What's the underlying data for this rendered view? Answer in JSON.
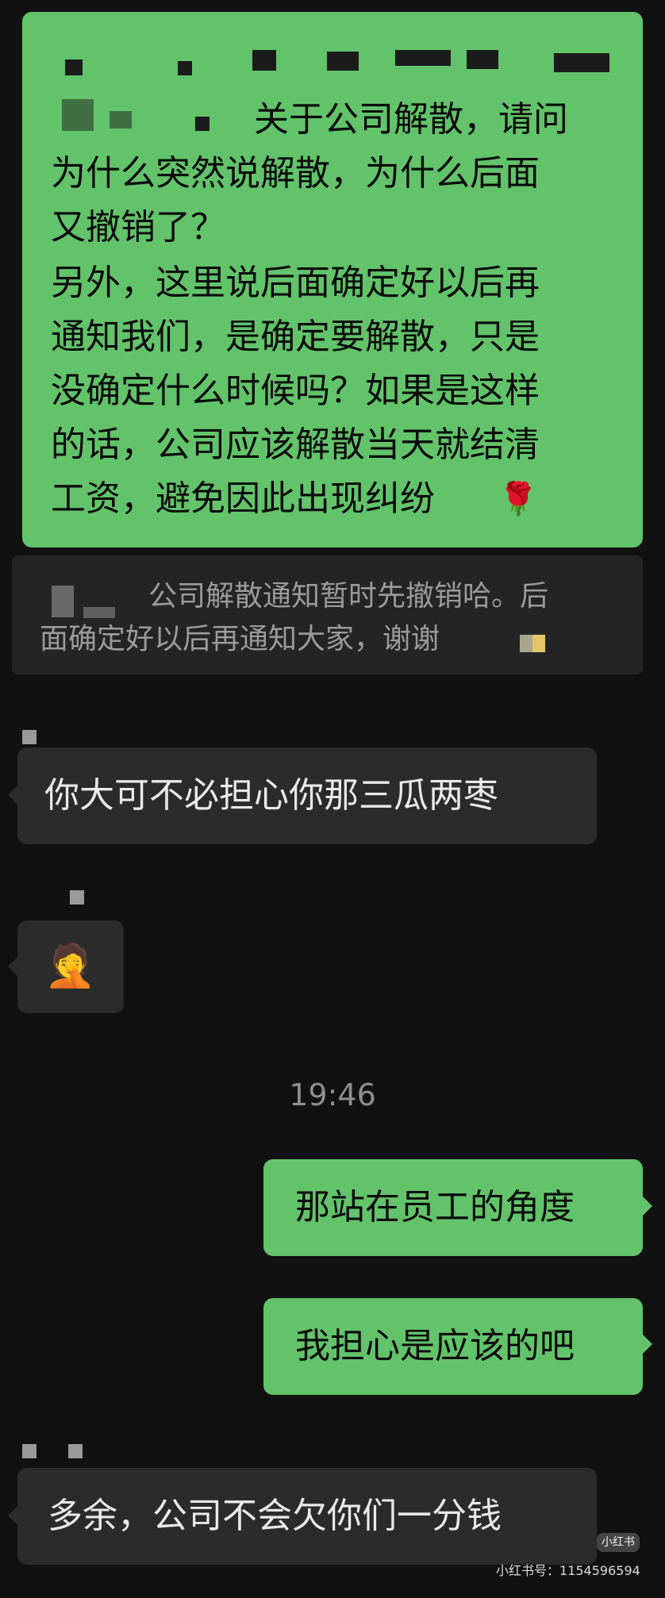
{
  "messages": {
    "m1": {
      "line1": "关于公司解散，请问",
      "line2": "为什么突然说解散，为什么后面",
      "line3": "又撤销了？",
      "line4": "另外，这里说后面确定好以后再",
      "line5": "通知我们，是确定要解散，只是",
      "line6": "没确定什么时候吗？如果是这样",
      "line7": "的话，公司应该解散当天就结清",
      "line8": "工资，避免因此出现纠纷",
      "emoji": "🌹"
    },
    "quote": {
      "line1": "公司解散通知暂时先撤销哈。后",
      "line2": "面确定好以后再通知大家，谢谢"
    },
    "m2": {
      "text": "你大可不必担心你那三瓜两枣"
    },
    "m3": {
      "emoji": "🤦"
    },
    "timestamp": "19:46",
    "m4": {
      "text": "那站在员工的角度"
    },
    "m5": {
      "text": "我担心是应该的吧"
    },
    "m6": {
      "text": "多余，公司不会欠你们一分钱"
    }
  },
  "watermark": {
    "logo": "小红书",
    "id": "小红书号：1154596594"
  },
  "colors": {
    "background": "#111111",
    "green_bubble": "#62c36a",
    "dark_bubble": "#2b2b2b"
  }
}
